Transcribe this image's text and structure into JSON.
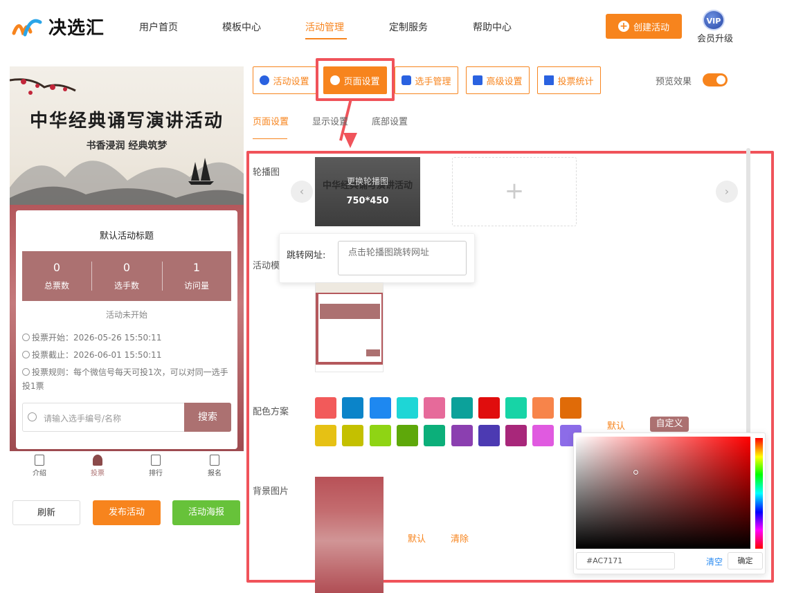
{
  "header": {
    "brand": "决选汇",
    "nav": [
      "用户首页",
      "模板中心",
      "活动管理",
      "定制服务",
      "帮助中心"
    ],
    "create_button": "创建活动",
    "vip_badge": "VIP",
    "vip_label": "会员升级"
  },
  "preview": {
    "banner_title": "中华经典诵写演讲活动",
    "banner_subtitle": "书香浸润  经典筑梦",
    "card_title": "默认活动标题",
    "stats": [
      {
        "value": "0",
        "label": "总票数"
      },
      {
        "value": "0",
        "label": "选手数"
      },
      {
        "value": "1",
        "label": "访问量"
      }
    ],
    "status": "活动未开始",
    "start": "投票开始：2026-05-26 15:50:11",
    "end": "投票截止：2026-06-01 15:50:11",
    "rule": "投票规则：每个微信号每天可投1次，可以对同一选手投1票",
    "search_placeholder": "请输入选手编号/名称",
    "search_button": "搜索",
    "tabbar": [
      "介绍",
      "投票",
      "排行",
      "报名"
    ],
    "refresh": "刷新",
    "publish": "发布活动",
    "poster": "活动海报"
  },
  "tabs": [
    "活动设置",
    "页面设置",
    "选手管理",
    "高级设置",
    "投票统计"
  ],
  "preview_label": "预览效果",
  "subtabs": [
    "页面设置",
    "显示设置",
    "底部设置"
  ],
  "form": {
    "carousel_label": "轮播图",
    "carousel_change": "更换轮播图",
    "carousel_size": "750*450",
    "add_symbol": "+",
    "jump_label": "跳转网址:",
    "jump_placeholder": "点击轮播图跳转网址",
    "template_label": "活动模",
    "color_label": "配色方案",
    "default_link": "默认",
    "custom_btn": "自定义",
    "bg_label": "背景图片",
    "bg_default": "默认",
    "bg_clear": "清除"
  },
  "colors": [
    "#f25a5a",
    "#0b84c9",
    "#1e88f0",
    "#1ed6d6",
    "#e66a9a",
    "#0ca19a",
    "#e00d0d",
    "#17d4a6",
    "#f7844a",
    "#e06b08",
    "#e6c114",
    "#c4c000",
    "#8fd414",
    "#5ea80a",
    "#0caf7a",
    "#8b3fb0",
    "#4c3ab2",
    "#a8277a",
    "#e05ae0",
    "#8c6ce8"
  ],
  "picker": {
    "hex": "#AC7171",
    "clear": "清空",
    "ok": "确定"
  },
  "accent": "#f7841d",
  "theme": "#ac7171"
}
